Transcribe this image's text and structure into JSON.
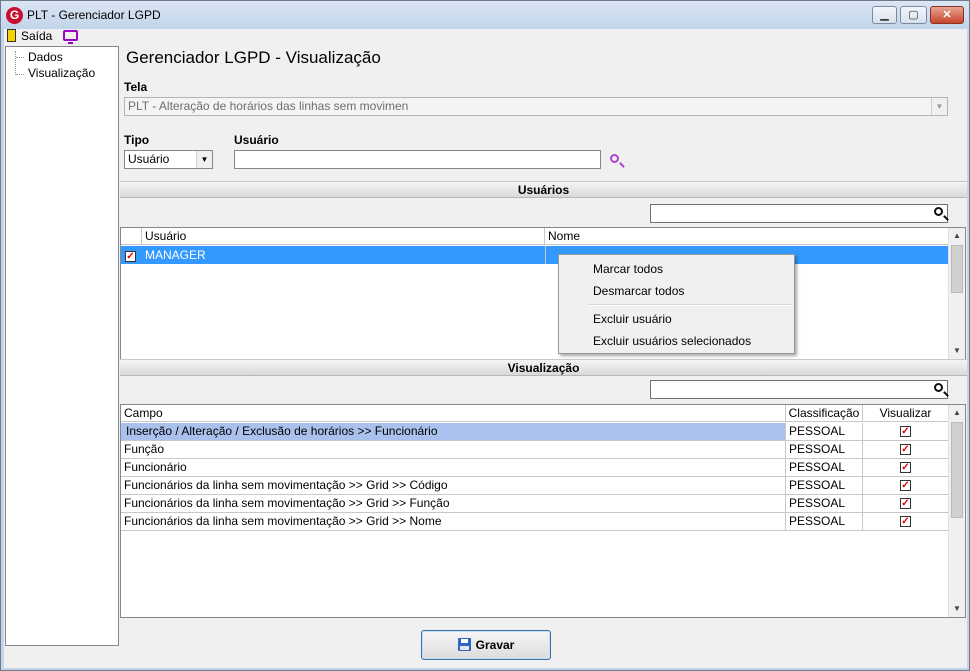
{
  "window": {
    "title": "PLT - Gerenciador LGPD",
    "logo_letter": "G",
    "buttons": {
      "minimize": "▁",
      "maximize": "▢",
      "close": "✕"
    }
  },
  "toolbar": {
    "exit_label": "Saída"
  },
  "tree": {
    "items": [
      "Dados",
      "Visualização"
    ]
  },
  "page_title": "Gerenciador LGPD - Visualização",
  "form": {
    "tela_label": "Tela",
    "tela_value": "PLT - Alteração de horários das linhas sem movimen",
    "tipo_label": "Tipo",
    "tipo_value": "Usuário",
    "usuario_label": "Usuário",
    "usuario_value": ""
  },
  "usuarios_section": {
    "title": "Usuários",
    "columns": [
      "Usuário",
      "Nome"
    ],
    "rows": [
      {
        "checked": true,
        "usuario": "MANAGER",
        "nome": ""
      }
    ]
  },
  "context_menu": {
    "items": [
      "Marcar todos",
      "Desmarcar todos",
      "Excluir usuário",
      "Excluir usuários selecionados"
    ]
  },
  "visualizacao_section": {
    "title": "Visualização",
    "columns": [
      "Campo",
      "Classificação",
      "Visualizar"
    ],
    "rows": [
      {
        "campo": "Inserção / Alteração / Exclusão de horários >> Funcionário",
        "classificacao": "PESSOAL",
        "visualizar": true
      },
      {
        "campo": "Função",
        "classificacao": "PESSOAL",
        "visualizar": true
      },
      {
        "campo": "Funcionário",
        "classificacao": "PESSOAL",
        "visualizar": true
      },
      {
        "campo": "Funcionários da linha sem movimentação >> Grid >> Código",
        "classificacao": "PESSOAL",
        "visualizar": true
      },
      {
        "campo": "Funcionários da linha sem movimentação >> Grid >> Função",
        "classificacao": "PESSOAL",
        "visualizar": true
      },
      {
        "campo": "Funcionários da linha sem movimentação >> Grid >> Nome",
        "classificacao": "PESSOAL",
        "visualizar": true
      }
    ]
  },
  "footer": {
    "save_label": "Gravar"
  },
  "colors": {
    "selection": "#3399ff",
    "row_highlight": "#a9c1ec",
    "check_red": "#e00000"
  }
}
